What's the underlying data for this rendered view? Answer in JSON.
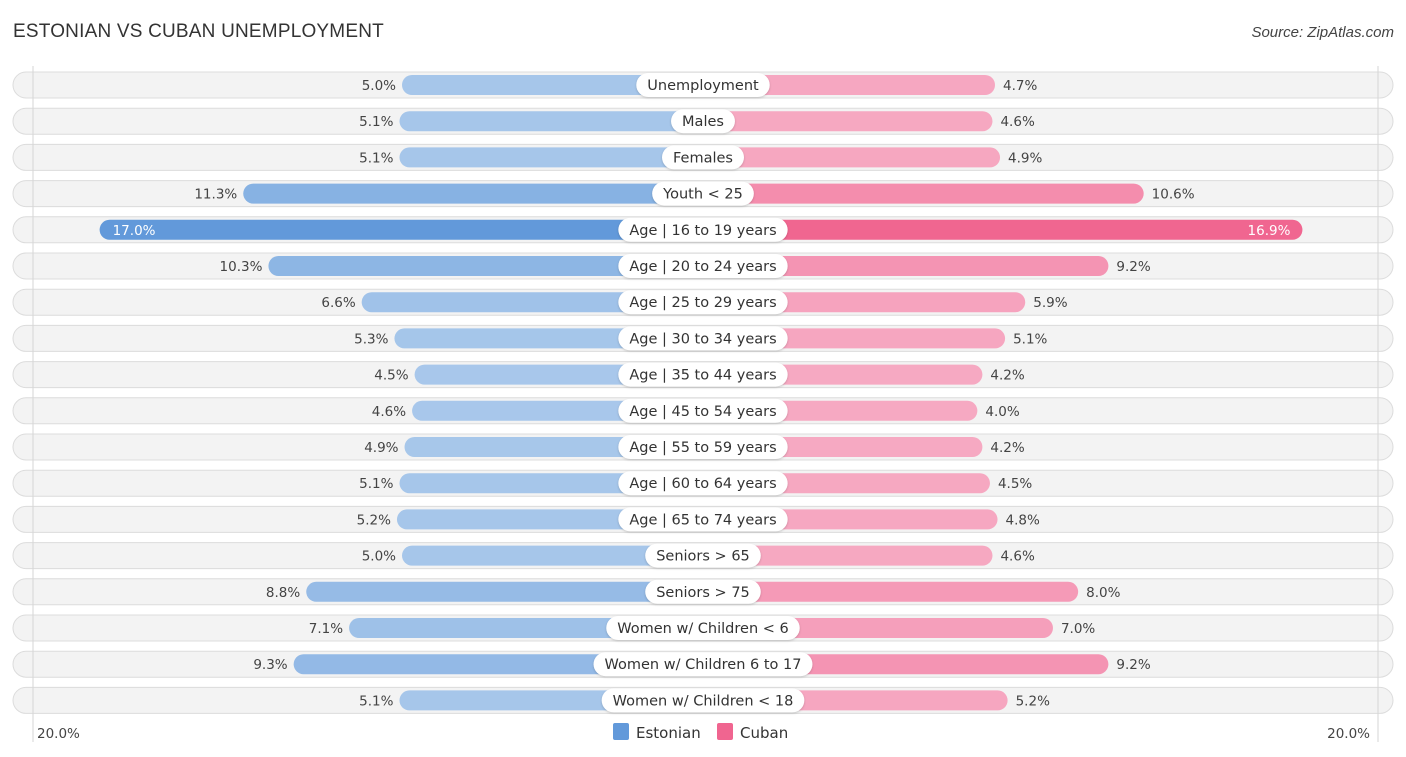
{
  "header": {
    "title": "ESTONIAN VS CUBAN UNEMPLOYMENT",
    "source": "Source: ZipAtlas.com"
  },
  "colors": {
    "estonian_light": "#a9c8eb",
    "estonian_strong": "#6299da",
    "cuban_light": "#f6a9c2",
    "cuban_strong": "#f06590"
  },
  "chart_data": {
    "type": "bar",
    "orientation": "horizontal-diverging",
    "title": "ESTONIAN VS CUBAN UNEMPLOYMENT",
    "categories": [
      "Unemployment",
      "Males",
      "Females",
      "Youth < 25",
      "Age | 16 to 19 years",
      "Age | 20 to 24 years",
      "Age | 25 to 29 years",
      "Age | 30 to 34 years",
      "Age | 35 to 44 years",
      "Age | 45 to 54 years",
      "Age | 55 to 59 years",
      "Age | 60 to 64 years",
      "Age | 65 to 74 years",
      "Seniors > 65",
      "Seniors > 75",
      "Women w/ Children < 6",
      "Women w/ Children 6 to 17",
      "Women w/ Children < 18"
    ],
    "series": [
      {
        "name": "Estonian",
        "side": "left",
        "values": [
          5.0,
          5.1,
          5.1,
          11.3,
          17.0,
          10.3,
          6.6,
          5.3,
          4.5,
          4.6,
          4.9,
          5.1,
          5.2,
          5.0,
          8.8,
          7.1,
          9.3,
          5.1
        ],
        "labels": [
          "5.0%",
          "5.1%",
          "5.1%",
          "11.3%",
          "17.0%",
          "10.3%",
          "6.6%",
          "5.3%",
          "4.5%",
          "4.6%",
          "4.9%",
          "5.1%",
          "5.2%",
          "5.0%",
          "8.8%",
          "7.1%",
          "9.3%",
          "5.1%"
        ]
      },
      {
        "name": "Cuban",
        "side": "right",
        "values": [
          4.7,
          4.6,
          4.9,
          10.6,
          16.9,
          9.2,
          5.9,
          5.1,
          4.2,
          4.0,
          4.2,
          4.5,
          4.8,
          4.6,
          8.0,
          7.0,
          9.2,
          5.2
        ],
        "labels": [
          "4.7%",
          "4.6%",
          "4.9%",
          "10.6%",
          "16.9%",
          "9.2%",
          "5.9%",
          "5.1%",
          "4.2%",
          "4.0%",
          "4.2%",
          "4.5%",
          "4.8%",
          "4.6%",
          "8.0%",
          "7.0%",
          "9.2%",
          "5.2%"
        ]
      }
    ],
    "xlim": [
      0,
      20.0
    ],
    "axis_labels": {
      "left": "20.0%",
      "right": "20.0%"
    },
    "unit": "%",
    "legend": {
      "position": "bottom-center",
      "entries": [
        "Estonian",
        "Cuban"
      ]
    },
    "grid": false
  }
}
